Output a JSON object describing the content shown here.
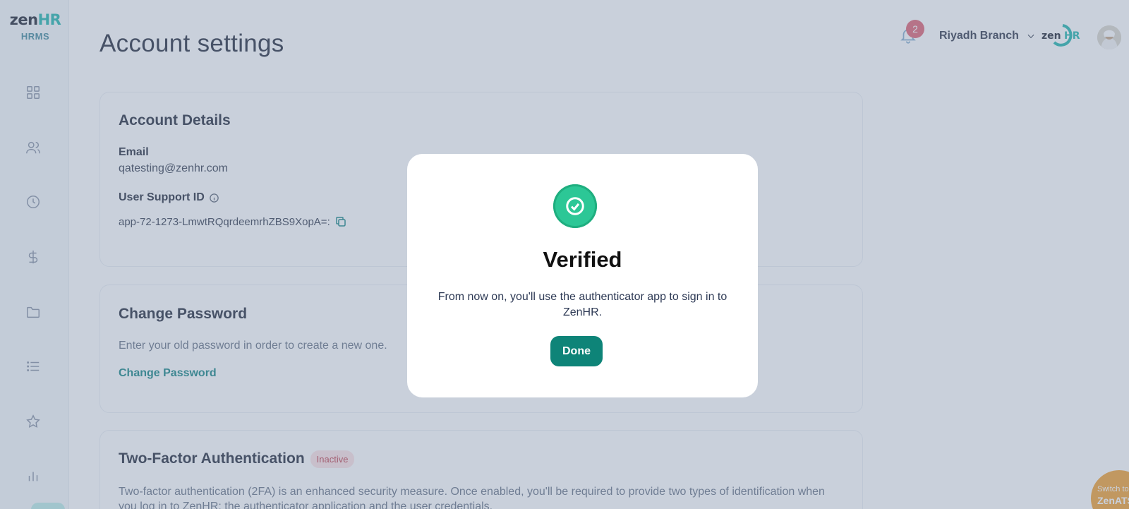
{
  "brand": {
    "logo_zen": "zen",
    "logo_hr": "HR",
    "logo_sub": "HRMS",
    "accent": "#0e8478",
    "teal": "#2bb8b0"
  },
  "sidebar": {
    "items": [
      {
        "icon": "dashboard-grid-icon"
      },
      {
        "icon": "people-icon"
      },
      {
        "icon": "clock-icon"
      },
      {
        "icon": "dollar-icon"
      },
      {
        "icon": "folder-icon"
      },
      {
        "icon": "list-icon"
      },
      {
        "icon": "star-icon"
      },
      {
        "icon": "bar-chart-icon"
      }
    ]
  },
  "header": {
    "title": "Account settings",
    "notifications_count": "2",
    "branch": "Riyadh Branch",
    "mini_logo_zen": "zen",
    "mini_logo_hr": "HR"
  },
  "account_details": {
    "title": "Account Details",
    "email_label": "Email",
    "email_value": "qatesting@zenhr.com",
    "support_label": "User Support ID",
    "support_value": "app-72-1273-LmwtRQqrdeemrhZBS9XopA=:"
  },
  "change_password": {
    "title": "Change Password",
    "description": "Enter your old password in order to create a new one.",
    "link": "Change Password"
  },
  "two_factor": {
    "title": "Two-Factor Authentication",
    "status": "Inactive",
    "description_line1": "Two-factor authentication (2FA) is an enhanced security measure. Once enabled, you'll be required to provide two types of identification when",
    "description_line2": "you log in to ZenHR: the authenticator application and the user credentials."
  },
  "switch": {
    "line1": "Switch to",
    "line2": "ZenATS"
  },
  "modal": {
    "title": "Verified",
    "message": "From now on, you'll use the authenticator app to sign in to ZenHR.",
    "button": "Done",
    "success_color": "#2cc796"
  }
}
